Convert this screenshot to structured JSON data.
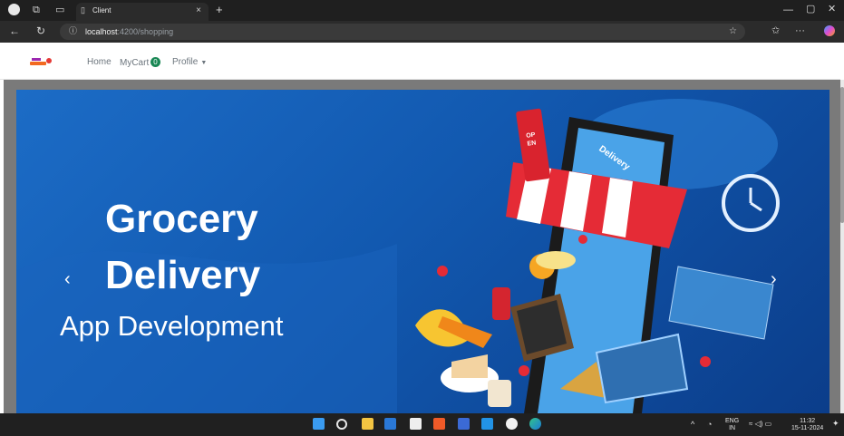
{
  "browser": {
    "tab_title": "Client",
    "tab_close": "×",
    "new_tab": "+",
    "url_host": "localhost",
    "url_path": ":4200/shopping",
    "window_min": "—",
    "window_max": "▢",
    "window_close": "✕"
  },
  "navbar": {
    "home": "Home",
    "mycart": "MyCart",
    "cart_count": "0",
    "profile": "Profile"
  },
  "hero": {
    "line1": "Grocery",
    "line2": "Delivery",
    "line3": "App Development",
    "sign_open": "OPEN",
    "awning_text": "Delivery",
    "prev": "‹",
    "next": "›"
  },
  "taskbar": {
    "lang_top": "ENG",
    "lang_bottom": "IN",
    "time": "11:32",
    "date": "15-11-2024"
  }
}
